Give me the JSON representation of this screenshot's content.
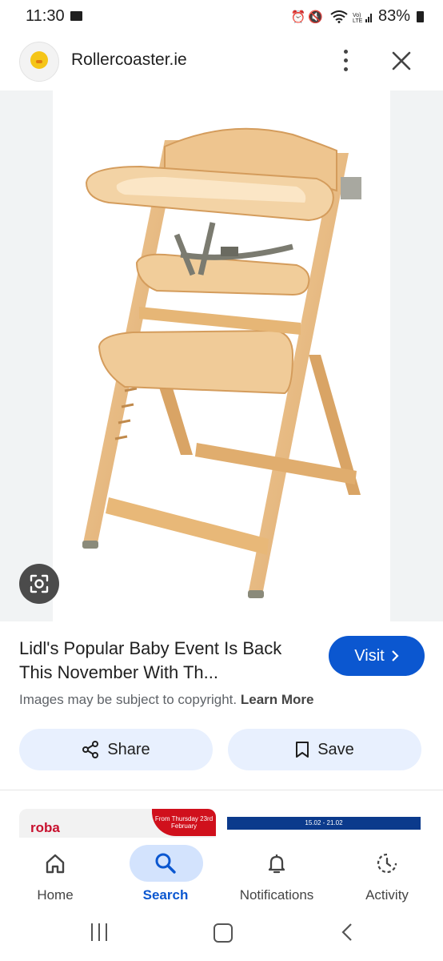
{
  "status_bar": {
    "time": "11:30",
    "battery": "83%",
    "icons": [
      "alarm-icon",
      "mute-icon",
      "wifi-icon",
      "volte-icon",
      "signal-icon",
      "battery-icon"
    ]
  },
  "header": {
    "site_name": "Rollercoaster.ie",
    "avatar": "rollercoaster-chick-logo"
  },
  "result": {
    "title": "Lidl's Popular Baby Event Is Back This November With Th...",
    "visit_label": "Visit",
    "copyright_text": "Images may be subject to copyright.",
    "learn_more": "Learn More",
    "share_label": "Share",
    "save_label": "Save"
  },
  "related": {
    "thumb1_brand": "roba",
    "thumb1_ribbon": "From Thursday 23rd February",
    "thumb2_dates": "15.02 - 21.02"
  },
  "bottom_nav": {
    "items": [
      {
        "label": "Home",
        "icon": "home-icon",
        "active": false
      },
      {
        "label": "Search",
        "icon": "search-icon",
        "active": true
      },
      {
        "label": "Notifications",
        "icon": "bell-icon",
        "active": false
      },
      {
        "label": "Activity",
        "icon": "activity-icon",
        "active": false
      }
    ]
  },
  "colors": {
    "accent": "#0b57d0",
    "action_bg": "#e8f0fe",
    "nav_active_bg": "#d3e3fd"
  }
}
